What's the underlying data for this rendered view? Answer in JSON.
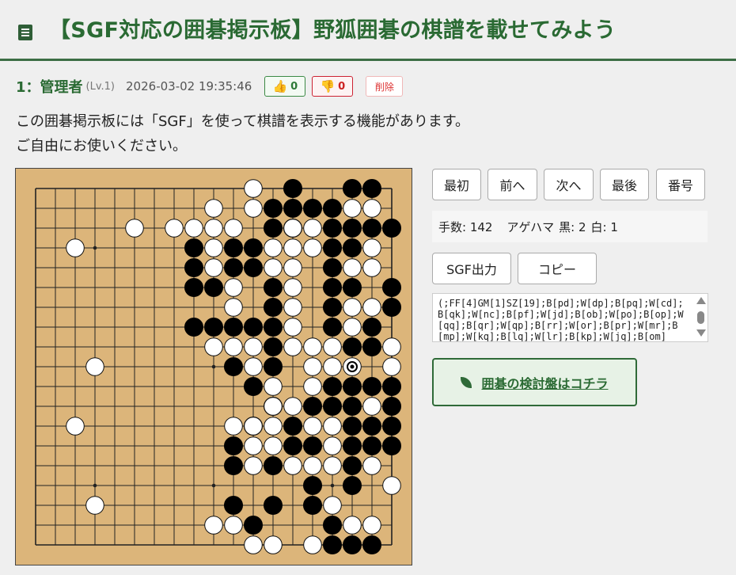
{
  "header": {
    "title": "【SGF対応の囲碁掲示板】野狐囲碁の棋譜を載せてみよう",
    "icon": "document-icon",
    "accent": "#2a6a33"
  },
  "post": {
    "number": "1：",
    "author": "管理者",
    "level": "(Lv.1)",
    "date": "2026-03-02 19:35:46",
    "good_count": "0",
    "bad_count": "0",
    "delete_label": "削除",
    "lines": [
      "この囲碁掲示板には「SGF」を使って棋譜を表示する機能があります。",
      "ご自由にお使いください。"
    ]
  },
  "nav": [
    "最初",
    "前へ",
    "次へ",
    "最後",
    "番号"
  ],
  "info": {
    "moves": "手数: 142",
    "captures_label": "アゲハマ",
    "black": "黒: 2",
    "white": "白: 1"
  },
  "sgf_buttons": [
    "SGF出力",
    "コピー"
  ],
  "sgf_text": "(;FF[4]GM[1]SZ[19];B[pd];W[dp];B[pq];W[cd];B[qk];W[nc];B[pf];W[jd];B[ob];W[po];B[op];W[qq];B[qr];W[qp];B[rr];W[or];B[pr];W[mr];B[mp];W[kq];B[lq];W[lr];B[kp];W[jq];B[om]",
  "kento_label": "囲碁の検討盤はコチラ",
  "board": {
    "size": 19,
    "colors": {
      "wood": "#dcb57a",
      "line": "#222",
      "black": "#000",
      "white": "#fff"
    },
    "black": [
      [
        13,
        0
      ],
      [
        16,
        0
      ],
      [
        17,
        0
      ],
      [
        12,
        1
      ],
      [
        13,
        1
      ],
      [
        14,
        1
      ],
      [
        15,
        1
      ],
      [
        12,
        2
      ],
      [
        13,
        2
      ],
      [
        15,
        2
      ],
      [
        16,
        2
      ],
      [
        17,
        2
      ],
      [
        18,
        2
      ],
      [
        8,
        3
      ],
      [
        10,
        3
      ],
      [
        11,
        3
      ],
      [
        15,
        3
      ],
      [
        16,
        3
      ],
      [
        8,
        4
      ],
      [
        10,
        4
      ],
      [
        11,
        4
      ],
      [
        15,
        4
      ],
      [
        8,
        5
      ],
      [
        9,
        5
      ],
      [
        12,
        5
      ],
      [
        15,
        5
      ],
      [
        16,
        5
      ],
      [
        18,
        5
      ],
      [
        12,
        6
      ],
      [
        15,
        6
      ],
      [
        18,
        6
      ],
      [
        8,
        7
      ],
      [
        9,
        7
      ],
      [
        10,
        7
      ],
      [
        11,
        7
      ],
      [
        12,
        7
      ],
      [
        15,
        7
      ],
      [
        17,
        7
      ],
      [
        12,
        8
      ],
      [
        16,
        8
      ],
      [
        17,
        8
      ],
      [
        10,
        9
      ],
      [
        12,
        9
      ],
      [
        11,
        10
      ],
      [
        15,
        10
      ],
      [
        16,
        10
      ],
      [
        17,
        10
      ],
      [
        18,
        10
      ],
      [
        12,
        11
      ],
      [
        14,
        11
      ],
      [
        15,
        11
      ],
      [
        16,
        11
      ],
      [
        18,
        11
      ],
      [
        11,
        12
      ],
      [
        13,
        12
      ],
      [
        16,
        12
      ],
      [
        17,
        12
      ],
      [
        18,
        12
      ],
      [
        10,
        13
      ],
      [
        13,
        13
      ],
      [
        14,
        13
      ],
      [
        16,
        13
      ],
      [
        17,
        13
      ],
      [
        18,
        13
      ],
      [
        10,
        14
      ],
      [
        12,
        14
      ],
      [
        16,
        14
      ],
      [
        14,
        15
      ],
      [
        16,
        15
      ],
      [
        10,
        16
      ],
      [
        12,
        16
      ],
      [
        14,
        16
      ],
      [
        11,
        17
      ],
      [
        15,
        17
      ],
      [
        15,
        18
      ],
      [
        16,
        18
      ],
      [
        17,
        18
      ]
    ],
    "white": [
      [
        11,
        0
      ],
      [
        9,
        1
      ],
      [
        11,
        1
      ],
      [
        16,
        1
      ],
      [
        17,
        1
      ],
      [
        5,
        2
      ],
      [
        7,
        2
      ],
      [
        8,
        2
      ],
      [
        9,
        2
      ],
      [
        10,
        2
      ],
      [
        13,
        2
      ],
      [
        14,
        2
      ],
      [
        2,
        3
      ],
      [
        9,
        3
      ],
      [
        12,
        3
      ],
      [
        13,
        3
      ],
      [
        14,
        3
      ],
      [
        17,
        3
      ],
      [
        9,
        4
      ],
      [
        12,
        4
      ],
      [
        13,
        4
      ],
      [
        16,
        4
      ],
      [
        17,
        4
      ],
      [
        10,
        5
      ],
      [
        13,
        5
      ],
      [
        10,
        6
      ],
      [
        13,
        6
      ],
      [
        16,
        6
      ],
      [
        17,
        6
      ],
      [
        13,
        7
      ],
      [
        16,
        7
      ],
      [
        9,
        8
      ],
      [
        10,
        8
      ],
      [
        11,
        8
      ],
      [
        13,
        8
      ],
      [
        14,
        8
      ],
      [
        15,
        8
      ],
      [
        18,
        8
      ],
      [
        3,
        9
      ],
      [
        11,
        9
      ],
      [
        14,
        9
      ],
      [
        15,
        9
      ],
      [
        18,
        9
      ],
      [
        12,
        10
      ],
      [
        14,
        10
      ],
      [
        12,
        11
      ],
      [
        13,
        11
      ],
      [
        17,
        11
      ],
      [
        2,
        12
      ],
      [
        10,
        12
      ],
      [
        11,
        12
      ],
      [
        12,
        12
      ],
      [
        14,
        12
      ],
      [
        15,
        12
      ],
      [
        11,
        13
      ],
      [
        12,
        13
      ],
      [
        15,
        13
      ],
      [
        11,
        14
      ],
      [
        13,
        14
      ],
      [
        14,
        14
      ],
      [
        15,
        14
      ],
      [
        17,
        14
      ],
      [
        18,
        15
      ],
      [
        3,
        16
      ],
      [
        15,
        16
      ],
      [
        9,
        17
      ],
      [
        10,
        17
      ],
      [
        16,
        17
      ],
      [
        17,
        17
      ],
      [
        11,
        18
      ],
      [
        12,
        18
      ],
      [
        14,
        18
      ]
    ],
    "last_move": [
      16,
      9
    ]
  }
}
